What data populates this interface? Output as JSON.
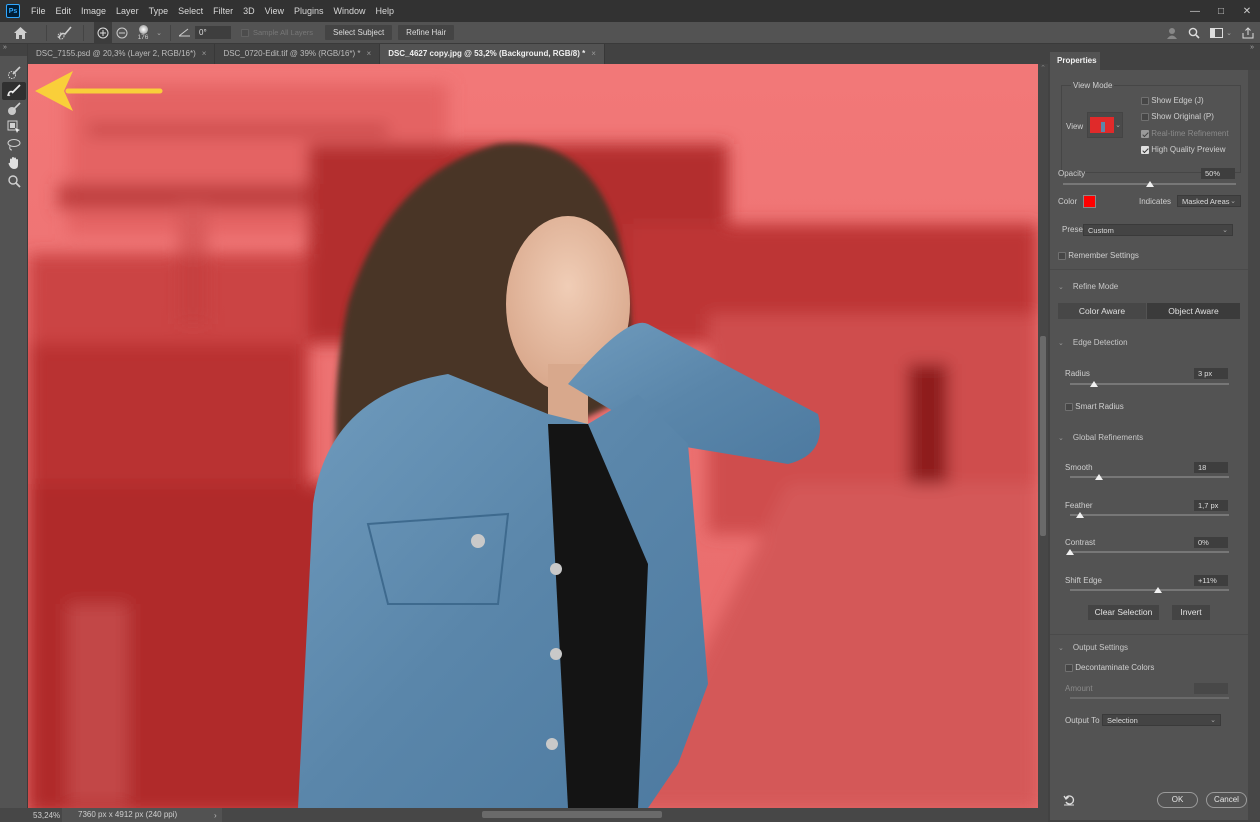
{
  "app": {
    "logo": "Ps",
    "menu": [
      "File",
      "Edit",
      "Image",
      "Layer",
      "Type",
      "Select",
      "Filter",
      "3D",
      "View",
      "Plugins",
      "Window",
      "Help"
    ],
    "window_controls": {
      "minimize": "—",
      "maximize": "□",
      "close": "✕"
    }
  },
  "options_bar": {
    "brush_size": "176",
    "angle": "0°",
    "sample_all_layers": {
      "label": "Sample All Layers",
      "checked": false,
      "disabled": true
    },
    "select_subject": "Select Subject",
    "refine_hair": "Refine Hair"
  },
  "tabs": [
    {
      "label": "DSC_7155.psd @ 20,3% (Layer 2, RGB/16*)",
      "close": "×",
      "active": false
    },
    {
      "label": "DSC_0720-Edit.tif @ 39% (RGB/16*) *",
      "close": "×",
      "active": false
    },
    {
      "label": "DSC_4627 copy.jpg @ 53,2% (Background, RGB/8) *",
      "close": "×",
      "active": true
    }
  ],
  "toolbar": {
    "collapse": "»",
    "tools": [
      {
        "name": "quick-selection-tool",
        "active": false
      },
      {
        "name": "refine-edge-brush-tool",
        "active": true
      },
      {
        "name": "brush-tool",
        "active": false
      },
      {
        "name": "object-selection-tool",
        "active": false
      },
      {
        "name": "lasso-tool",
        "active": false
      },
      {
        "name": "hand-tool",
        "active": false
      },
      {
        "name": "zoom-tool",
        "active": false
      }
    ]
  },
  "status": {
    "zoom": "53,24%",
    "doc_info": "7360 px x 4912 px (240 ppi)",
    "more": "›"
  },
  "properties": {
    "title": "Properties",
    "view_mode": {
      "heading": "View Mode",
      "view_label": "View",
      "show_edge": {
        "label": "Show Edge (J)",
        "checked": false
      },
      "show_original": {
        "label": "Show Original (P)",
        "checked": false
      },
      "realtime_refinement": {
        "label": "Real-time Refinement",
        "checked": true,
        "disabled": true
      },
      "high_quality_preview": {
        "label": "High Quality Preview",
        "checked": true
      }
    },
    "opacity": {
      "label": "Opacity",
      "value": "50%",
      "fraction": 0.5
    },
    "color": {
      "label": "Color",
      "swatch": "#ff0000"
    },
    "indicates": {
      "label": "Indicates",
      "value": "Masked Areas"
    },
    "preset": {
      "label": "Preset",
      "value": "Custom"
    },
    "remember_settings": {
      "label": "Remember Settings",
      "checked": false
    },
    "refine_mode": {
      "heading": "Refine Mode",
      "options": [
        "Color Aware",
        "Object Aware"
      ],
      "selected": "Object Aware"
    },
    "edge_detection": {
      "heading": "Edge Detection",
      "radius": {
        "label": "Radius",
        "value": "3 px",
        "fraction": 0.15
      },
      "smart_radius": {
        "label": "Smart Radius",
        "checked": false
      }
    },
    "global_refinements": {
      "heading": "Global Refinements",
      "smooth": {
        "label": "Smooth",
        "value": "18",
        "fraction": 0.18
      },
      "feather": {
        "label": "Feather",
        "value": "1,7 px",
        "fraction": 0.06
      },
      "contrast": {
        "label": "Contrast",
        "value": "0%",
        "fraction": 0.0
      },
      "shift_edge": {
        "label": "Shift Edge",
        "value": "+11%",
        "fraction": 0.555
      }
    },
    "clear_selection": "Clear Selection",
    "invert": "Invert",
    "output_settings": {
      "heading": "Output Settings",
      "decontaminate": {
        "label": "Decontaminate Colors",
        "checked": false
      },
      "amount": {
        "label": "Amount",
        "value": ""
      },
      "output_to": {
        "label": "Output To",
        "value": "Selection"
      }
    },
    "ok": "OK",
    "cancel": "Cancel"
  },
  "annotation": {
    "arrow_color": "#f9cf3a",
    "points_to": "refine-edge-brush-tool"
  },
  "colors": {
    "overlay": "#ff0000",
    "ui_bg": "#535353",
    "menubar": "#323232"
  }
}
